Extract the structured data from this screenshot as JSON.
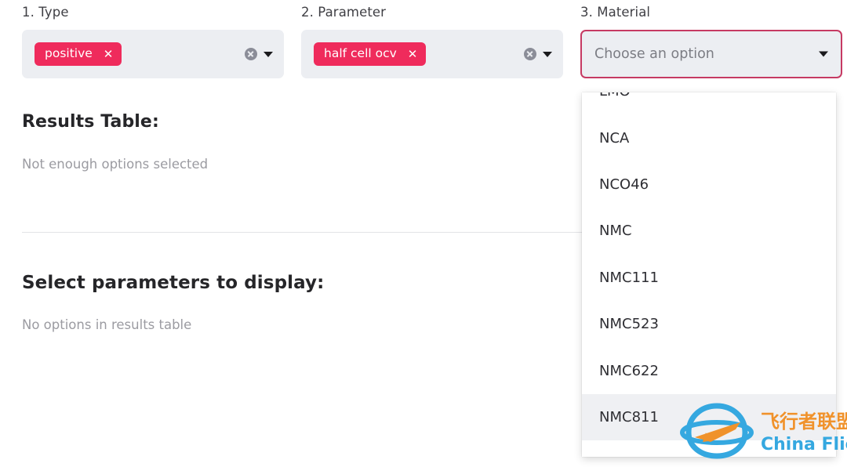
{
  "selectors": [
    {
      "label": "1. Type",
      "name": "type",
      "chips": [
        {
          "text": "positive"
        }
      ],
      "clear_icon": "clear-circle-icon",
      "caret_icon": "chevron-down-icon",
      "state": "closed"
    },
    {
      "label": "2. Parameter",
      "name": "parameter",
      "chips": [
        {
          "text": "half cell ocv"
        }
      ],
      "clear_icon": "clear-circle-icon",
      "caret_icon": "chevron-down-icon",
      "state": "closed"
    },
    {
      "label": "3. Material",
      "name": "material",
      "placeholder": "Choose an option",
      "caret_icon": "chevron-down-icon",
      "state": "open"
    }
  ],
  "dropdown": {
    "options": [
      {
        "label": "LMO",
        "highlighted": false
      },
      {
        "label": "NCA",
        "highlighted": false
      },
      {
        "label": "NCO46",
        "highlighted": false
      },
      {
        "label": "NMC",
        "highlighted": false
      },
      {
        "label": "NMC111",
        "highlighted": false
      },
      {
        "label": "NMC523",
        "highlighted": false
      },
      {
        "label": "NMC622",
        "highlighted": false
      },
      {
        "label": "NMC811",
        "highlighted": true
      }
    ]
  },
  "results_section": {
    "title": "Results Table:",
    "empty_message": "Not enough options selected"
  },
  "parameters_section": {
    "title": "Select parameters to display:",
    "empty_message": "No options in results table"
  },
  "watermark": {
    "chinese_text": "飞行者联盟",
    "english_text": "China Flier",
    "icon": "plane-orbit-logo-icon"
  },
  "colors": {
    "chip_pink": "#EF2B5C",
    "focus_border": "#C63A63",
    "field_background": "#ECEEF2",
    "highlight_row": "#EFF0F3",
    "watermark_blue": "#35A8E0",
    "watermark_orange": "#F0922B"
  }
}
